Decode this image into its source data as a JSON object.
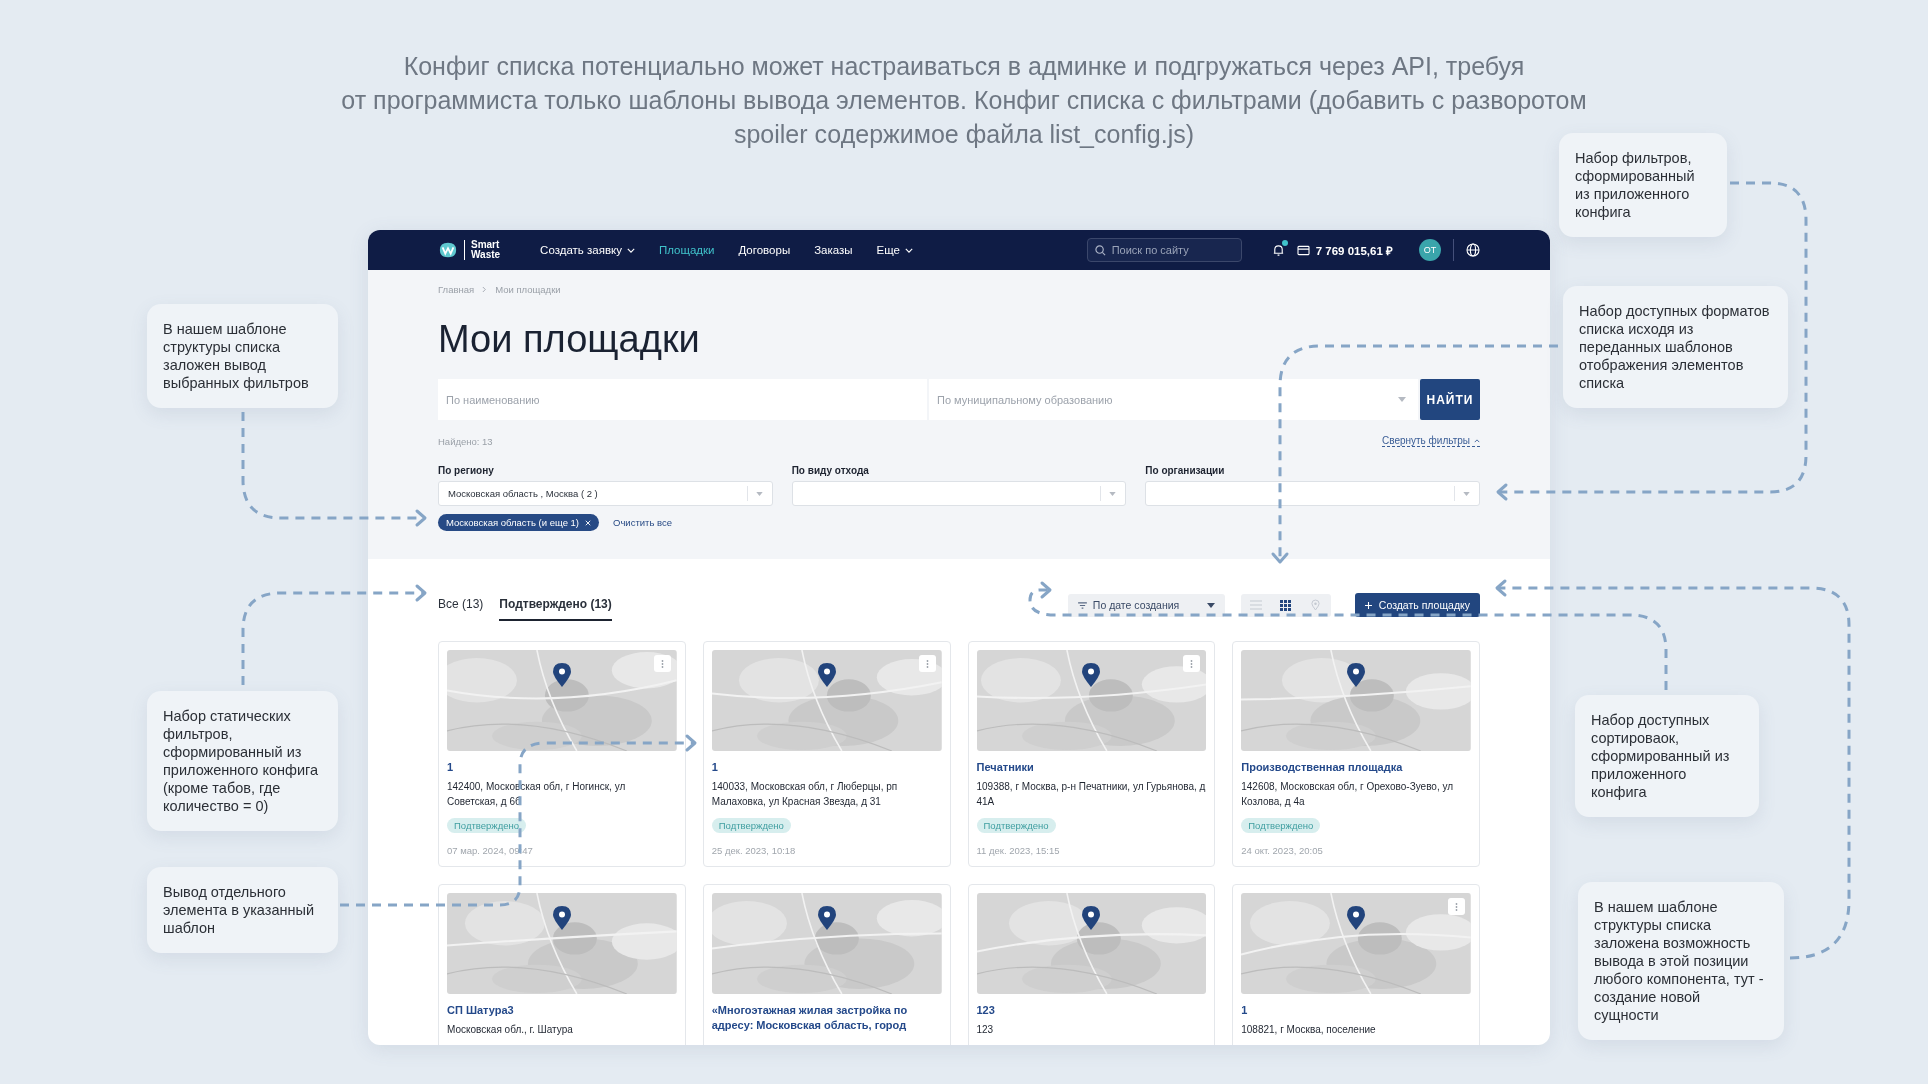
{
  "heading": "Конфиг списка потенциально может настраиваться в админке и подгружаться через API, требуя\nот программиста только шаблоны вывода элементов. Конфиг списка с фильтрами (добавить с разворотом\nspoiler содержимое файла list_config.js)",
  "app": {
    "navbar": {
      "logo": "Smart\nWaste",
      "menu": [
        {
          "label": "Создать заявку",
          "dropdown": true,
          "selected": false
        },
        {
          "label": "Площадки",
          "dropdown": false,
          "selected": true
        },
        {
          "label": "Договоры",
          "dropdown": false,
          "selected": false
        },
        {
          "label": "Заказы",
          "dropdown": false,
          "selected": false
        },
        {
          "label": "Еще",
          "dropdown": true,
          "selected": false
        }
      ],
      "search": {
        "placeholder": "Поиск по сайту"
      },
      "has_unread": true,
      "balance": "7 769 015,61 ₽",
      "avatar": "ОТ"
    },
    "breadcrumbs": [
      "Главная",
      "Мои площадки"
    ],
    "title": "Мои площадки",
    "search_fields": [
      {
        "kind": "text",
        "placeholder": "По наименованию"
      },
      {
        "kind": "select",
        "placeholder": "По муниципальному образованию"
      }
    ],
    "search_button": "НАЙТИ",
    "found": "Найдено: 13",
    "collapse_filters": "Свернуть фильтры",
    "filters": [
      {
        "label": "По региону",
        "value": "Московская область , Москва ( 2 )"
      },
      {
        "label": "По виду отхода"
      },
      {
        "label": "По организации"
      }
    ],
    "chips": [
      {
        "label": "Московская область (и еще 1)"
      }
    ],
    "clear_all": "Очистить все",
    "tabs": [
      {
        "label": "Все (13)",
        "selected": false
      },
      {
        "label": "Подтверждено (13)",
        "selected": true
      }
    ],
    "sort": {
      "value": "По дате создания"
    },
    "view_modes": [
      {
        "kind": "list",
        "selected": false
      },
      {
        "kind": "grid",
        "selected": true
      },
      {
        "kind": "map",
        "selected": false
      }
    ],
    "create_button": "Создать площадку",
    "cards": [
      {
        "title": "1",
        "address": "142400, Московская обл, г Ногинск, ул Советская, д 6б",
        "status": "Подтверждено",
        "date": "07 мар. 2024, 09:47",
        "has_menu": true
      },
      {
        "title": "1",
        "address": "140033, Московская обл, г Люберцы, рп Малаховка, ул Красная Звезда, д 31",
        "status": "Подтверждено",
        "date": "25 дек. 2023, 10:18",
        "has_menu": true
      },
      {
        "title": "Печатники",
        "address": "109388, г Москва, р-н Печатники, ул Гурьянова, д 41А",
        "status": "Подтверждено",
        "date": "11 дек. 2023, 15:15",
        "has_menu": true
      },
      {
        "title": "Производственная площадка",
        "address": "142608, Московская обл, г Орехово-Зуево, ул Козлова, д 4а",
        "status": "Подтверждено",
        "date": "24 окт. 2023, 20:05",
        "has_menu": false
      },
      {
        "title": "СП Шатура3",
        "address": "Московская обл., г. Шатура",
        "has_menu": false
      },
      {
        "title": "«Многоэтажная жилая застройка по адресу: Московская область, город",
        "has_menu": false
      },
      {
        "title": "123",
        "address": "123",
        "has_menu": false
      },
      {
        "title": "1",
        "address": "108821, г Москва, поселение",
        "has_menu": true
      }
    ]
  },
  "notes": [
    {
      "text": "В нашем шаблоне структуры списка заложен вывод выбранных фильтров"
    },
    {
      "text": "Набор статических фильтров, сформированный из приложенного конфига (кроме табов, где количество = 0)"
    },
    {
      "text": "Вывод отдельного элемента в указанный шаблон"
    },
    {
      "text": "Набор фильтров, сформированный из приложенного конфига"
    },
    {
      "text": "Набор доступных форматов списка исходя из переданных шаблонов отображения элементов списка"
    },
    {
      "text": "Набор доступных сортироваок, сформированный из приложенного конфига"
    },
    {
      "text": "В нашем шаблоне структуры списка заложена возможность вывода в этой позиции любого компонента, тут - создание новой сущности"
    }
  ]
}
